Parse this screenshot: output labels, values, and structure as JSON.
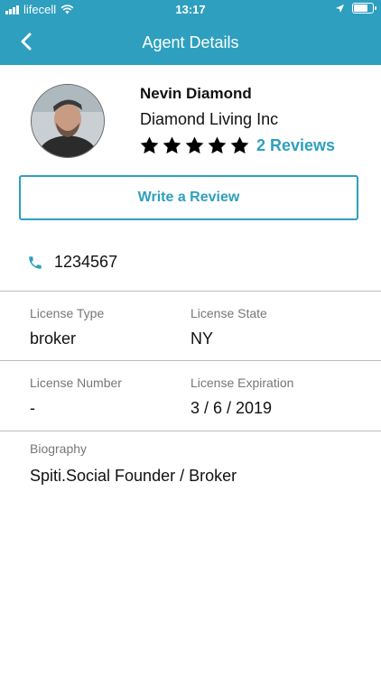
{
  "status_bar": {
    "carrier": "lifecell",
    "time": "13:17",
    "battery_level": 0.85
  },
  "header": {
    "title": "Agent Details",
    "back_icon": "chevron-left-icon"
  },
  "agent": {
    "name": "Nevin Diamond",
    "company": "Diamond Living Inc",
    "rating": 5,
    "max_rating": 5,
    "reviews_label": "2 Reviews"
  },
  "actions": {
    "write_review_label": "Write a Review"
  },
  "contact": {
    "phone": "1234567",
    "phone_icon": "phone-icon"
  },
  "license": {
    "type_label": "License Type",
    "type_value": "broker",
    "state_label": "License State",
    "state_value": "NY",
    "number_label": "License Number",
    "number_value": "-",
    "expiration_label": "License Expiration",
    "expiration_value": "3 / 6 / 2019"
  },
  "biography": {
    "label": "Biography",
    "value": "Spiti.Social Founder / Broker"
  },
  "colors": {
    "accent": "#2e9fbf",
    "divider": "#bdbdbd",
    "label_gray": "#777777"
  }
}
